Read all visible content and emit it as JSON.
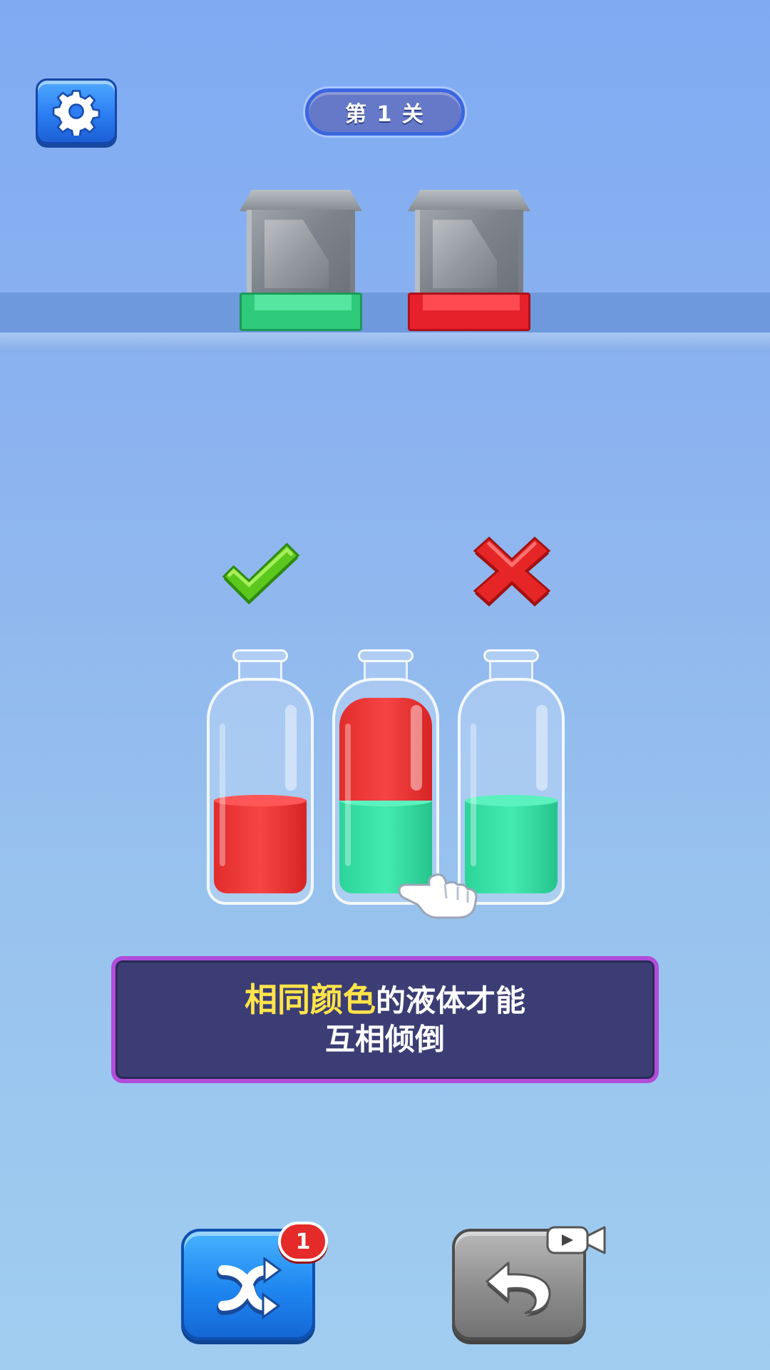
{
  "header": {
    "level_label": "第 1 关",
    "settings_icon": "gear-icon"
  },
  "boxes": [
    {
      "color": "#2fca7a",
      "name": "green-box"
    },
    {
      "color": "#e6212c",
      "name": "red-box"
    }
  ],
  "indicators": {
    "correct_icon": "checkmark-icon",
    "wrong_icon": "cross-icon"
  },
  "bottles": [
    {
      "layers": [
        "red"
      ],
      "fill_fraction": 0.5
    },
    {
      "layers": [
        "green",
        "red"
      ],
      "fill_fraction": 0.95
    },
    {
      "layers": [
        "green"
      ],
      "fill_fraction": 0.5
    }
  ],
  "hint": {
    "highlight": "相同颜色",
    "rest_line1": "的液体才能",
    "line2": "互相倾倒"
  },
  "buttons": {
    "shuffle_icon": "shuffle-icon",
    "shuffle_count": "1",
    "undo_icon": "undo-icon",
    "video_icon": "video-camera-icon"
  },
  "colors": {
    "liquid_red": "#f03a3a",
    "liquid_green": "#3ce3a8",
    "hint_highlight": "#ffe34a",
    "hint_border": "#b24cda"
  }
}
